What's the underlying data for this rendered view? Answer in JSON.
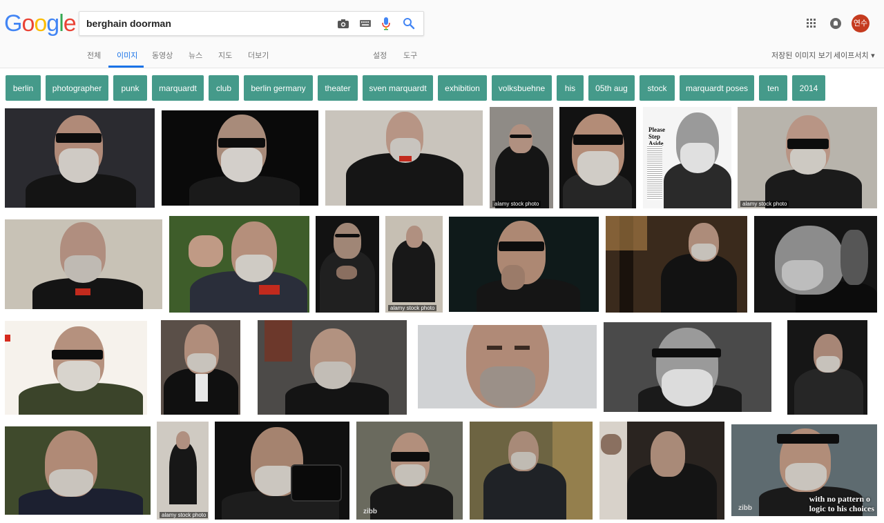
{
  "logo": {
    "letters": [
      "G",
      "o",
      "o",
      "g",
      "l",
      "e"
    ],
    "colors": [
      "#4285f4",
      "#ea4335",
      "#fbbc05",
      "#4285f4",
      "#34a853",
      "#ea4335"
    ]
  },
  "search": {
    "query": "berghain doorman"
  },
  "account": {
    "avatar_text": "연수",
    "avatar_color": "#c53b1f"
  },
  "nav": {
    "tabs": [
      "전체",
      "이미지",
      "동영상",
      "뉴스",
      "지도",
      "더보기"
    ],
    "active": "이미지",
    "settings": "설정",
    "tools": "도구"
  },
  "right_links": {
    "saved_images": "저장된 이미지 보기",
    "safesearch": "세이프서치 ▾"
  },
  "chips": [
    "berlin",
    "photographer",
    "punk",
    "marquardt",
    "club",
    "berlin germany",
    "theater",
    "sven marquardt",
    "exhibition",
    "volksbuehne",
    "his",
    "05th aug",
    "stock",
    "marquardt poses",
    "ten",
    "2014"
  ],
  "chip_color": "#459a8a",
  "tile_texts": {
    "alamy": "alamy stock photo",
    "magazine_title": "Please Step Aside",
    "zibb": "zibb",
    "caption_line1": "with no pattern o",
    "caption_line2": "logic to his choices"
  }
}
